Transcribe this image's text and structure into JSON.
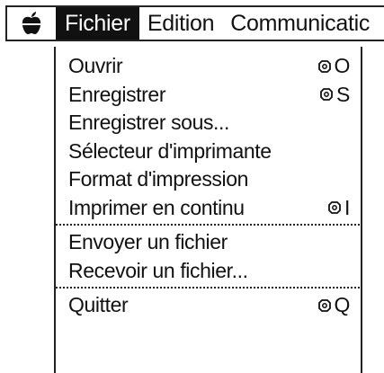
{
  "menubar": {
    "apple_icon": "apple-logo-icon",
    "menus": [
      "Fichier",
      "Edition",
      "Communicatic"
    ]
  },
  "dropdown": {
    "items": [
      {
        "label": "Ouvrir",
        "shortcut_icon": "command-key-icon",
        "shortcut_key": "O"
      },
      {
        "label": "Enregistrer",
        "shortcut_icon": "command-key-icon",
        "shortcut_key": "S"
      },
      {
        "label": "Enregistrer sous..."
      },
      {
        "label": "Sélecteur d'imprimante"
      },
      {
        "label": "Format d'impression"
      },
      {
        "label": "Imprimer en continu",
        "shortcut_icon": "command-key-icon",
        "shortcut_key": "I"
      },
      {
        "label": "Envoyer un fichier"
      },
      {
        "label": "Recevoir un fichier..."
      },
      {
        "label": "Quitter",
        "shortcut_icon": "command-key-icon",
        "shortcut_key": "Q"
      }
    ]
  }
}
